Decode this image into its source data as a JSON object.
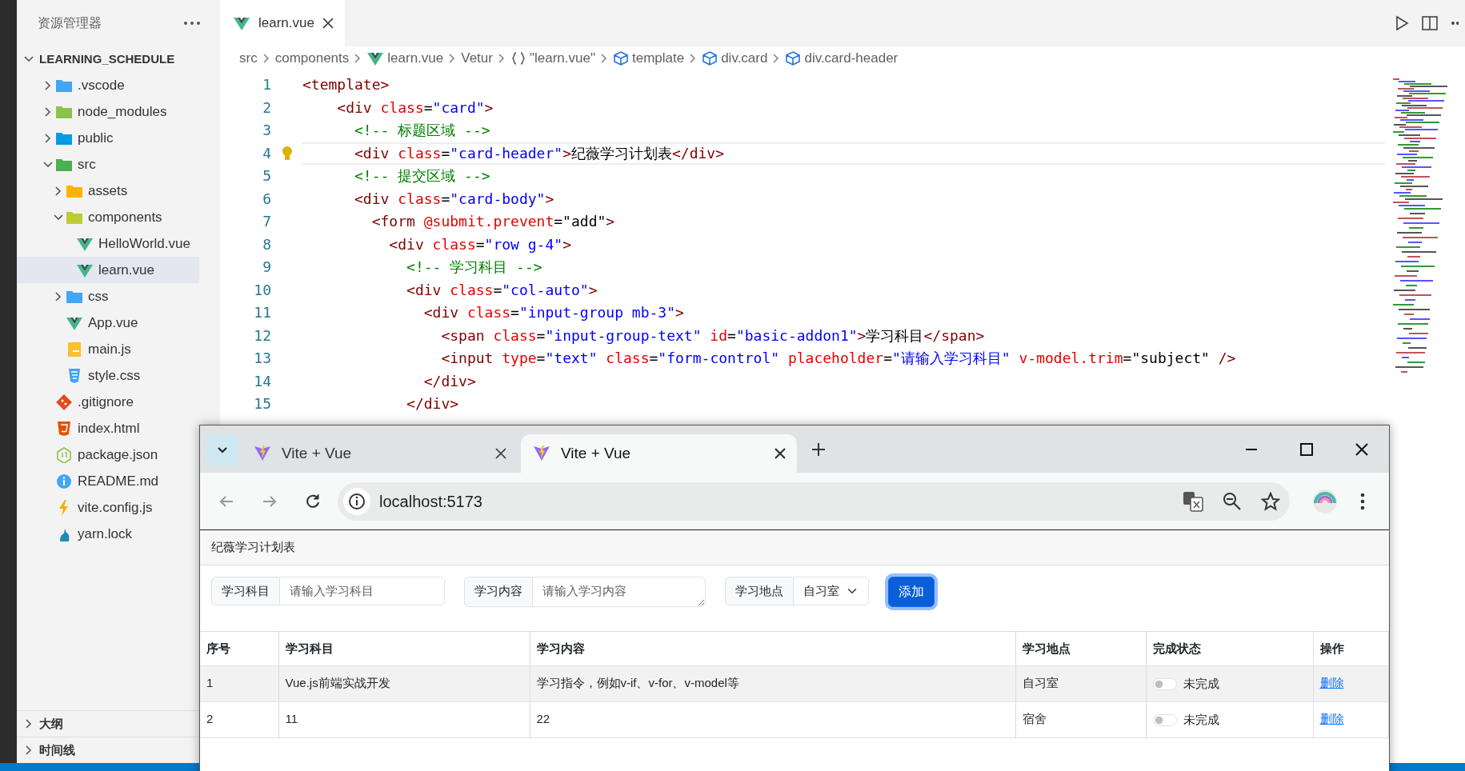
{
  "explorer": {
    "title": "资源管理器",
    "section": {
      "label": "LEARNING_SCHEDULE",
      "expanded": true
    },
    "tree": [
      {
        "label": ".vscode",
        "kind": "folder",
        "color": "#42a5f5",
        "expanded": false,
        "selected": false
      },
      {
        "label": "node_modules",
        "kind": "folder",
        "color": "#8bc34a",
        "expanded": false,
        "selected": false
      },
      {
        "label": "public",
        "kind": "folder",
        "color": "#039be5",
        "expanded": false,
        "selected": false
      },
      {
        "label": "src",
        "kind": "folder",
        "color": "#4caf50",
        "expanded": true,
        "selected": false,
        "children": [
          {
            "label": "assets",
            "kind": "folder",
            "color": "#ffb300",
            "expanded": false,
            "selected": false
          },
          {
            "label": "components",
            "kind": "folder",
            "color": "#c0ca33",
            "expanded": true,
            "selected": false,
            "children": [
              {
                "label": "HelloWorld.vue",
                "kind": "vue",
                "selected": false
              },
              {
                "label": "learn.vue",
                "kind": "vue",
                "selected": true
              }
            ]
          },
          {
            "label": "css",
            "kind": "folder",
            "color": "#42a5f5",
            "expanded": false,
            "selected": false
          },
          {
            "label": "App.vue",
            "kind": "vue",
            "selected": false
          },
          {
            "label": "main.js",
            "kind": "js",
            "selected": false
          },
          {
            "label": "style.css",
            "kind": "css",
            "selected": false
          }
        ]
      },
      {
        "label": ".gitignore",
        "kind": "git",
        "selected": false
      },
      {
        "label": "index.html",
        "kind": "html",
        "selected": false
      },
      {
        "label": "package.json",
        "kind": "json",
        "selected": false
      },
      {
        "label": "README.md",
        "kind": "info",
        "selected": false
      },
      {
        "label": "vite.config.js",
        "kind": "vite",
        "selected": false
      },
      {
        "label": "yarn.lock",
        "kind": "yarn",
        "selected": false
      }
    ],
    "panels": [
      {
        "label": "大纲",
        "expanded": false
      },
      {
        "label": "时间线",
        "expanded": false
      }
    ]
  },
  "editor": {
    "tabs": [
      {
        "label": "learn.vue",
        "selected": true
      }
    ],
    "breadcrumbs": [
      {
        "kind": "text",
        "label": "src"
      },
      {
        "kind": "text",
        "label": "components"
      },
      {
        "kind": "vue",
        "label": "learn.vue"
      },
      {
        "kind": "text",
        "label": "Vetur"
      },
      {
        "kind": "object",
        "label": "\"learn.vue\""
      },
      {
        "kind": "element",
        "label": "template"
      },
      {
        "kind": "element",
        "label": "div.card"
      },
      {
        "kind": "element",
        "label": "div.card-header"
      }
    ],
    "lines": [
      {
        "number": "1",
        "current": false,
        "tokens": [
          {
            "kind": "tag",
            "text": "<template>"
          }
        ]
      },
      {
        "number": "2",
        "current": false,
        "tokens": [
          {
            "kind": "tag",
            "text": "    <div"
          },
          {
            "kind": "attr",
            "text": " class"
          },
          {
            "kind": "text",
            "text": "="
          },
          {
            "kind": "string",
            "text": "\"card\""
          },
          {
            "kind": "tag",
            "text": ">"
          }
        ]
      },
      {
        "number": "3",
        "current": false,
        "tokens": [
          {
            "kind": "comment",
            "text": "      <!-- 标题区域 -->"
          }
        ]
      },
      {
        "number": "4",
        "current": true,
        "tokens": [
          {
            "kind": "tag",
            "text": "      <div"
          },
          {
            "kind": "attr",
            "text": " class"
          },
          {
            "kind": "text",
            "text": "="
          },
          {
            "kind": "string",
            "text": "\"card-header\""
          },
          {
            "kind": "tag",
            "text": ">"
          },
          {
            "kind": "text",
            "text": "纪薇学习计划表"
          },
          {
            "kind": "tag",
            "text": "</div>"
          }
        ]
      },
      {
        "number": "5",
        "current": false,
        "tokens": [
          {
            "kind": "comment",
            "text": "      <!-- 提交区域 -->"
          }
        ]
      },
      {
        "number": "6",
        "current": false,
        "tokens": [
          {
            "kind": "tag",
            "text": "      <div"
          },
          {
            "kind": "attr",
            "text": " class"
          },
          {
            "kind": "text",
            "text": "="
          },
          {
            "kind": "string",
            "text": "\"card-body\""
          },
          {
            "kind": "tag",
            "text": ">"
          }
        ]
      },
      {
        "number": "7",
        "current": false,
        "tokens": [
          {
            "kind": "tag",
            "text": "        <form"
          },
          {
            "kind": "attr",
            "text": " @submit.prevent"
          },
          {
            "kind": "text",
            "text": "=\"add\""
          },
          {
            "kind": "tag",
            "text": ">"
          }
        ]
      },
      {
        "number": "8",
        "current": false,
        "tokens": [
          {
            "kind": "tag",
            "text": "          <div"
          },
          {
            "kind": "attr",
            "text": " class"
          },
          {
            "kind": "text",
            "text": "="
          },
          {
            "kind": "string",
            "text": "\"row g-4\""
          },
          {
            "kind": "tag",
            "text": ">"
          }
        ]
      },
      {
        "number": "9",
        "current": false,
        "tokens": [
          {
            "kind": "comment",
            "text": "            <!-- 学习科目 -->"
          }
        ]
      },
      {
        "number": "10",
        "current": false,
        "tokens": [
          {
            "kind": "tag",
            "text": "            <div"
          },
          {
            "kind": "attr",
            "text": " class"
          },
          {
            "kind": "text",
            "text": "="
          },
          {
            "kind": "string",
            "text": "\"col-auto\""
          },
          {
            "kind": "tag",
            "text": ">"
          }
        ]
      },
      {
        "number": "11",
        "current": false,
        "tokens": [
          {
            "kind": "tag",
            "text": "              <div"
          },
          {
            "kind": "attr",
            "text": " class"
          },
          {
            "kind": "text",
            "text": "="
          },
          {
            "kind": "string",
            "text": "\"input-group mb-3\""
          },
          {
            "kind": "tag",
            "text": ">"
          }
        ]
      },
      {
        "number": "12",
        "current": false,
        "tokens": [
          {
            "kind": "tag",
            "text": "                <span"
          },
          {
            "kind": "attr",
            "text": " class"
          },
          {
            "kind": "text",
            "text": "="
          },
          {
            "kind": "string",
            "text": "\"input-group-text\""
          },
          {
            "kind": "attr",
            "text": " id"
          },
          {
            "kind": "text",
            "text": "="
          },
          {
            "kind": "string",
            "text": "\"basic-addon1\""
          },
          {
            "kind": "tag",
            "text": ">"
          },
          {
            "kind": "text",
            "text": "学习科目"
          },
          {
            "kind": "tag",
            "text": "</span>"
          }
        ]
      },
      {
        "number": "13",
        "current": false,
        "tokens": [
          {
            "kind": "tag",
            "text": "                <input"
          },
          {
            "kind": "attr",
            "text": " type"
          },
          {
            "kind": "text",
            "text": "="
          },
          {
            "kind": "string",
            "text": "\"text\""
          },
          {
            "kind": "attr",
            "text": " class"
          },
          {
            "kind": "text",
            "text": "="
          },
          {
            "kind": "string",
            "text": "\"form-control\""
          },
          {
            "kind": "attr",
            "text": " placeholder"
          },
          {
            "kind": "text",
            "text": "="
          },
          {
            "kind": "string",
            "text": "\"请输入学习科目\""
          },
          {
            "kind": "attr",
            "text": " v-model.trim"
          },
          {
            "kind": "text",
            "text": "=\"subject\""
          },
          {
            "kind": "tag",
            "text": " />"
          }
        ]
      },
      {
        "number": "14",
        "current": false,
        "tokens": [
          {
            "kind": "tag",
            "text": "              </div>"
          }
        ]
      },
      {
        "number": "15",
        "current": false,
        "tokens": [
          {
            "kind": "tag",
            "text": "            </div>"
          }
        ]
      }
    ]
  },
  "browser": {
    "tabs": [
      {
        "label": "Vite + Vue",
        "selected": false
      },
      {
        "label": "Vite + Vue",
        "selected": true
      }
    ],
    "url": "localhost:5173",
    "page": {
      "header": "纪薇学习计划表",
      "fields": [
        {
          "kind": "input",
          "label": "学习科目",
          "placeholder": "请输入学习科目"
        },
        {
          "kind": "textarea",
          "label": "学习内容",
          "placeholder": "请输入学习内容"
        },
        {
          "kind": "select",
          "label": "学习地点",
          "value": "自习室"
        }
      ],
      "submit": "添加",
      "table": {
        "columns": [
          "序号",
          "学习科目",
          "学习内容",
          "学习地点",
          "完成状态",
          "操作"
        ],
        "rows": [
          {
            "index": "1",
            "subject": "Vue.js前端实战开发",
            "content": "学习指令，例如v-if、v-for、v-model等",
            "place": "自习室",
            "done": false,
            "status": "未完成",
            "action": "删除"
          },
          {
            "index": "2",
            "subject": "11",
            "content": "22",
            "place": "宿舍",
            "done": false,
            "status": "未完成",
            "action": "删除"
          }
        ]
      }
    }
  }
}
